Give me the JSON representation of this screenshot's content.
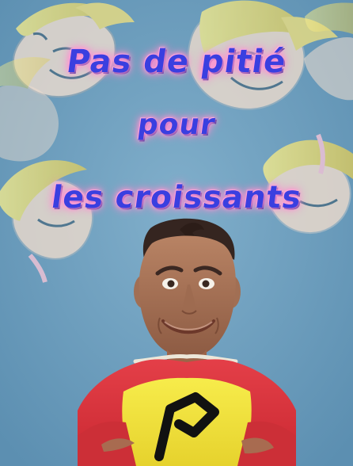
{
  "title": {
    "line1": "Pas de pitié",
    "line2": "pour",
    "line3": "les croissants"
  },
  "colors": {
    "title_fill": "#3a3fe0",
    "title_glow": "#ff8dd0",
    "background": "#6a9bb8",
    "costume_red": "#e2343d",
    "costume_yellow": "#f1e12f",
    "emblem_black": "#111111"
  },
  "icons": {
    "background": "cartoon-faces-illustration",
    "character": "superhero-man-portrait",
    "emblem": "p-emblem-icon"
  }
}
